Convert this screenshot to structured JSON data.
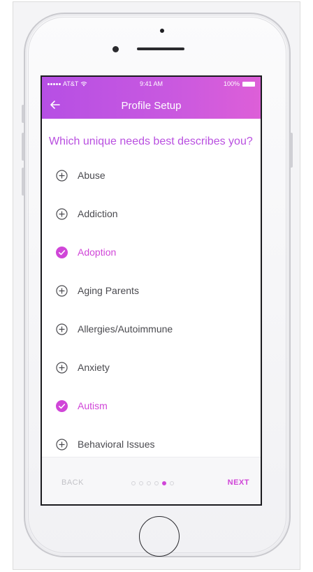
{
  "status_bar": {
    "carrier": "AT&T",
    "time": "9:41 AM",
    "battery": "100%"
  },
  "header": {
    "title": "Profile Setup"
  },
  "question": "Which unique needs best describes you?",
  "options": [
    {
      "label": "Abuse",
      "selected": false
    },
    {
      "label": "Addiction",
      "selected": false
    },
    {
      "label": "Adoption",
      "selected": true
    },
    {
      "label": "Aging Parents",
      "selected": false
    },
    {
      "label": "Allergies/Autoimmune",
      "selected": false
    },
    {
      "label": "Anxiety",
      "selected": false
    },
    {
      "label": "Autism",
      "selected": true
    },
    {
      "label": "Behavioral Issues",
      "selected": false
    }
  ],
  "footer": {
    "back_label": "BACK",
    "next_label": "NEXT",
    "page_count": 6,
    "current_page": 5
  },
  "icons": {
    "unselected": "plus-circle-icon",
    "selected": "check-circle-icon"
  },
  "colors": {
    "accent": "#d046d8",
    "header_start": "#b64fe4",
    "header_end": "#dd5fd8",
    "question": "#b94fe0",
    "text": "#4a4a4f"
  }
}
